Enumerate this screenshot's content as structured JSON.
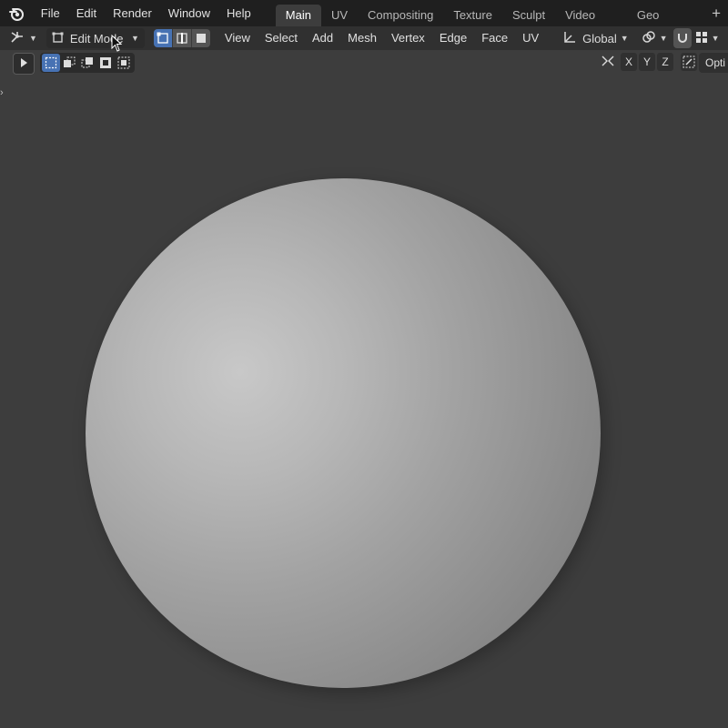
{
  "menu": [
    "File",
    "Edit",
    "Render",
    "Window",
    "Help"
  ],
  "workspace_tabs": [
    {
      "label": "Main",
      "active": true
    },
    {
      "label": "UV",
      "active": false
    },
    {
      "label": "Compositing",
      "active": false
    },
    {
      "label": "Texture",
      "active": false
    },
    {
      "label": "Sculpt",
      "active": false
    },
    {
      "label": "Video Edit",
      "active": false
    },
    {
      "label": "Geo Nodes",
      "active": false
    }
  ],
  "workspace_add": "+",
  "header": {
    "mode_label": "Edit Mode",
    "menus": [
      "View",
      "Select",
      "Add",
      "Mesh",
      "Vertex",
      "Edge",
      "Face",
      "UV"
    ],
    "orientation": "Global"
  },
  "axes": [
    "X",
    "Y",
    "Z"
  ],
  "options_label": "Opti",
  "colors": {
    "accent": "#4772b3",
    "topbar": "#1f1f1f",
    "header": "#303030",
    "viewport": "#3d3d3d"
  }
}
